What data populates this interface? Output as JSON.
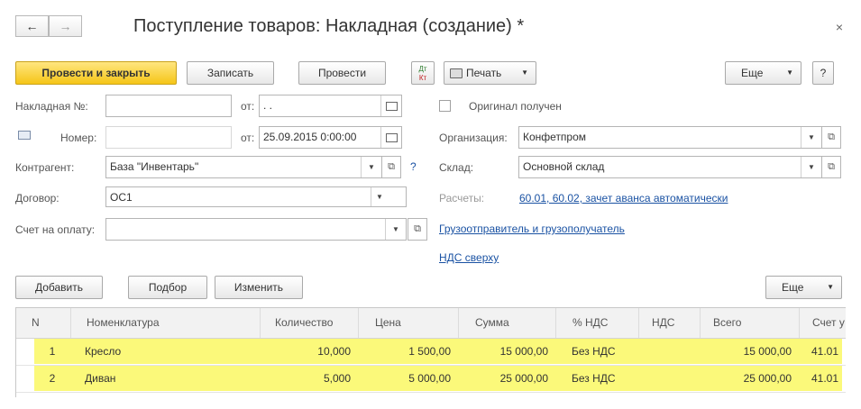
{
  "window": {
    "title": "Поступление товаров: Накладная (создание) *",
    "back_icon": "←",
    "forward_icon": "→",
    "close_icon": "×"
  },
  "toolbar": {
    "post_close": "Провести и закрыть",
    "save": "Записать",
    "post": "Провести",
    "dtkt_top": "Дт",
    "dtkt_bottom": "Кт",
    "print": "Печать",
    "more": "Еще",
    "help": "?"
  },
  "form": {
    "invoice_no_label": "Накладная №:",
    "invoice_no_value": "",
    "from1_label": "от:",
    "from1_value": ". .",
    "number_label": "Номер:",
    "number_value": "",
    "from2_label": "от:",
    "from2_value": "25.09.2015  0:00:00",
    "contractor_label": "Контрагент:",
    "contractor_value": "База \"Инвентарь\"",
    "contractor_help": "?",
    "contract_label": "Договор:",
    "contract_value": "ОС1",
    "payment_label": "Счет на оплату:",
    "payment_value": "",
    "original_label": "Оригинал получен",
    "org_label": "Организация:",
    "org_value": "Конфетпром",
    "warehouse_label": "Склад:",
    "warehouse_value": "Основной склад",
    "accounts_label": "Расчеты:",
    "accounts_link": "60.01, 60.02, зачет аванса автоматически",
    "shipper_link": "Грузоотправитель и грузополучатель",
    "vat_link": "НДС сверху"
  },
  "table_toolbar": {
    "add": "Добавить",
    "select": "Подбор",
    "edit": "Изменить",
    "more": "Еще"
  },
  "table": {
    "columns": [
      "N",
      "Номенклатура",
      "Количество",
      "Цена",
      "Сумма",
      "% НДС",
      "НДС",
      "Всего",
      "Счет у"
    ],
    "rows": [
      {
        "n": "1",
        "item": "Кресло",
        "qty": "10,000",
        "price": "1 500,00",
        "sum": "15 000,00",
        "vat_rate": "Без НДС",
        "vat": "",
        "total": "15 000,00",
        "account": "41.01"
      },
      {
        "n": "2",
        "item": "Диван",
        "qty": "5,000",
        "price": "5 000,00",
        "sum": "25 000,00",
        "vat_rate": "Без НДС",
        "vat": "",
        "total": "25 000,00",
        "account": "41.01"
      }
    ]
  },
  "colors": {
    "primary_button": "#f5c518",
    "row_highlight": "#fbf97a",
    "link": "#1a52a3"
  }
}
